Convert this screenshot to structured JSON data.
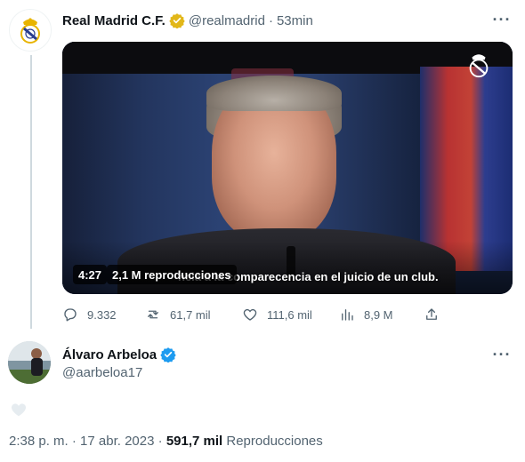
{
  "tweet": {
    "display_name": "Real Madrid C.F.",
    "handle": "@realmadrid",
    "separator": "·",
    "time": "53min",
    "verified_color": "#e2b719",
    "video": {
      "duration": "4:27",
      "views": "2,1 M reproducciones",
      "caption": "ncia a la comparecencia en el juicio de un club."
    },
    "actions": {
      "replies": "9.332",
      "retweets": "61,7 mil",
      "likes": "111,6 mil",
      "views": "8,9 M"
    }
  },
  "reply_user": {
    "display_name": "Álvaro Arbeloa",
    "handle": "@aarbeloa17",
    "verified_color": "#1d9bf0"
  },
  "footer": {
    "time": "2:38 p. m.",
    "sep1": " · ",
    "date": "17 abr. 2023",
    "sep2": " · ",
    "view_count": "591,7 mil",
    "view_label": " Reproducciones"
  },
  "colors": {
    "text_secondary": "#536471",
    "thread_line": "#cfd9de"
  }
}
